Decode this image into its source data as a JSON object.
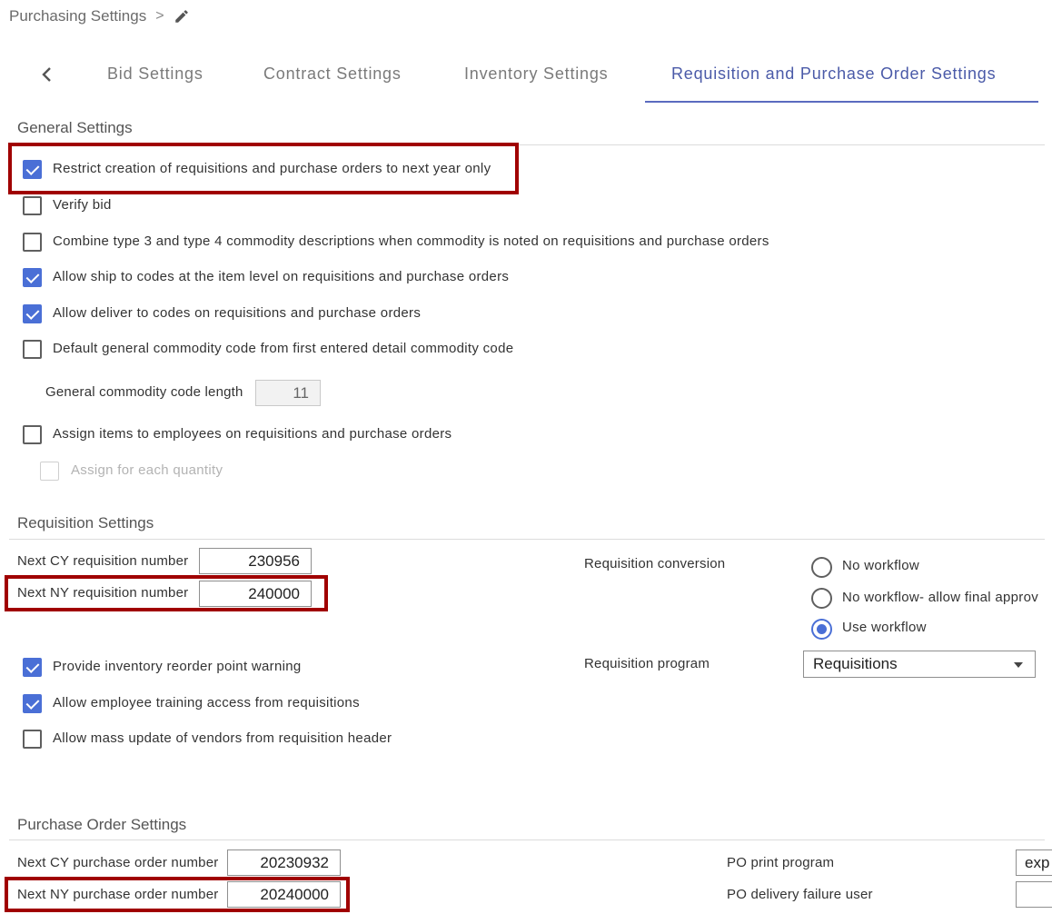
{
  "breadcrumb": {
    "label": "Purchasing Settings",
    "separator": ">"
  },
  "tabs": [
    {
      "label": "Bid Settings"
    },
    {
      "label": "Contract Settings"
    },
    {
      "label": "Inventory Settings"
    },
    {
      "label": "Requisition and Purchase Order Settings",
      "active": true
    }
  ],
  "general": {
    "title": "General Settings",
    "options": [
      {
        "label": "Restrict creation of requisitions and purchase orders to next year only",
        "checked": true
      },
      {
        "label": "Verify bid",
        "checked": false
      },
      {
        "label": "Combine type 3 and type 4 commodity descriptions when commodity is noted on requisitions and purchase orders",
        "checked": false
      },
      {
        "label": "Allow ship to codes at the item level on requisitions and purchase orders",
        "checked": true
      },
      {
        "label": "Allow deliver to codes on requisitions and purchase orders",
        "checked": true
      },
      {
        "label": "Default general commodity code from first entered detail commodity code",
        "checked": false
      }
    ],
    "commodity_length_label": "General commodity code length",
    "commodity_length_value": "11",
    "assign_items": {
      "label": "Assign items to employees on requisitions and purchase orders",
      "checked": false
    },
    "assign_each": {
      "label": "Assign for each quantity",
      "checked": false,
      "disabled": true
    }
  },
  "requisition": {
    "title": "Requisition Settings",
    "next_cy_label": "Next CY requisition number",
    "next_cy_value": "230956",
    "next_ny_label": "Next NY requisition number",
    "next_ny_value": "240000",
    "conversion_label": "Requisition conversion",
    "conversion_options": [
      {
        "label": "No workflow",
        "selected": false
      },
      {
        "label": "No workflow- allow final approv",
        "selected": false
      },
      {
        "label": "Use workflow",
        "selected": true
      }
    ],
    "program_label": "Requisition program",
    "program_value": "Requisitions",
    "options": [
      {
        "label": "Provide inventory reorder point warning",
        "checked": true
      },
      {
        "label": "Allow employee training access from requisitions",
        "checked": true
      },
      {
        "label": "Allow mass update of vendors from requisition header",
        "checked": false
      }
    ]
  },
  "purchase_order": {
    "title": "Purchase Order Settings",
    "next_cy_label": "Next CY purchase order number",
    "next_cy_value": "20230932",
    "next_ny_label": "Next NY purchase order number",
    "next_ny_value": "20240000",
    "print_program_label": "PO print program",
    "print_program_value": "exp",
    "delivery_failure_label": "PO delivery failure user",
    "delivery_failure_value": ""
  },
  "colors": {
    "accent": "#4a6fd6",
    "tab_active": "#4a5aa8",
    "highlight": "#a00000"
  },
  "icons": {
    "breadcrumb_edit": "pencil-icon",
    "back": "chevron-left-icon",
    "dropdown": "caret-down-icon"
  }
}
